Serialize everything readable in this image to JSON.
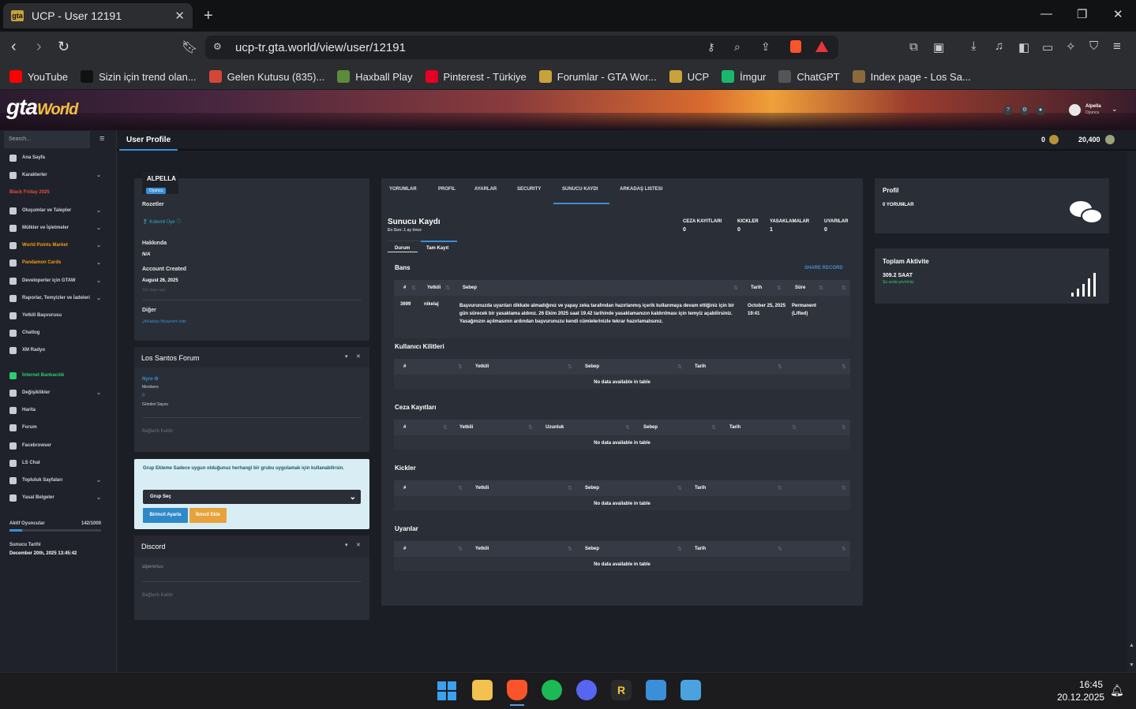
{
  "browser": {
    "tab_title": "UCP - User 12191",
    "url": "ucp-tr.gta.world/view/user/12191",
    "bookmarks": [
      {
        "label": "YouTube",
        "icon": "youtube-icon",
        "color": "#ff0000"
      },
      {
        "label": "Sizin için trend olan...",
        "icon": "tiktok-icon",
        "color": "#111111"
      },
      {
        "label": "Gelen Kutusu (835)...",
        "icon": "gmail-icon",
        "color": "#d44638"
      },
      {
        "label": "Haxball Play",
        "icon": "haxball-icon",
        "color": "#5b8c3a"
      },
      {
        "label": "Pinterest - Türkiye",
        "icon": "pinterest-icon",
        "color": "#e60023"
      },
      {
        "label": "Forumlar - GTA Wor...",
        "icon": "gtaw-icon",
        "color": "#c9a23c"
      },
      {
        "label": "UCP",
        "icon": "gtaw-icon",
        "color": "#c9a23c"
      },
      {
        "label": "İmgur",
        "icon": "imgur-icon",
        "color": "#1bb76e"
      },
      {
        "label": "ChatGPT",
        "icon": "chatgpt-icon",
        "color": "#555555"
      },
      {
        "label": "Index page - Los Sa...",
        "icon": "lspd-icon",
        "color": "#8a6a3a"
      }
    ]
  },
  "site": {
    "logo": "gta",
    "logo_sub": "World",
    "user_name": "Alpella",
    "user_role": "Oyuncu",
    "search_placeholder": "Search...",
    "page_tab": "User Profile",
    "coins": "0",
    "points": "20,400"
  },
  "sidebar": {
    "items": [
      {
        "label": "Ana Sayfa",
        "chev": false,
        "color": "#cfd3da"
      },
      {
        "label": "Karakterler",
        "chev": true,
        "color": "#cfd3da"
      },
      {
        "label": "Black Friday 2025",
        "chev": false,
        "color": "#e74c3c"
      },
      {
        "label": "Oluşumlar ve Talepler",
        "chev": true,
        "color": "#cfd3da"
      },
      {
        "label": "Mülkler ve İşletmeler",
        "chev": true,
        "color": "#cfd3da"
      },
      {
        "label": "World Points Market",
        "chev": true,
        "color": "#f39c12"
      },
      {
        "label": "Pandamon Cards",
        "chev": true,
        "color": "#f39c12"
      },
      {
        "label": "Developerler için GTAW",
        "chev": true,
        "color": "#cfd3da"
      },
      {
        "label": "Raporlar, Temyizler ve İadeleri",
        "chev": true,
        "color": "#cfd3da"
      },
      {
        "label": "Yetkili Başvurusu",
        "chev": false,
        "color": "#cfd3da"
      },
      {
        "label": "Chatlog",
        "chev": false,
        "color": "#cfd3da"
      },
      {
        "label": "XM Radyo",
        "chev": false,
        "color": "#cfd3da"
      },
      {
        "label": "İnternet Bankacılık",
        "chev": false,
        "color": "#2ecc71"
      },
      {
        "label": "Değişiklikler",
        "chev": true,
        "color": "#cfd3da"
      },
      {
        "label": "Harita",
        "chev": false,
        "color": "#cfd3da"
      },
      {
        "label": "Forum",
        "chev": false,
        "color": "#cfd3da"
      },
      {
        "label": "Facebrowser",
        "chev": false,
        "color": "#cfd3da"
      },
      {
        "label": "LS Chat",
        "chev": false,
        "color": "#cfd3da"
      },
      {
        "label": "Topluluk Sayfaları",
        "chev": true,
        "color": "#cfd3da"
      },
      {
        "label": "Yasal Belgeler",
        "chev": true,
        "color": "#cfd3da"
      }
    ],
    "active_players_label": "Aktif Oyuncular",
    "active_players": "142/1000",
    "active_fraction": 0.142,
    "server_date_label": "Sunucu Tarihi",
    "server_date": "December 20th, 2025 13:45:42"
  },
  "profile": {
    "name": "ALPELLA",
    "role": "Oyuncu",
    "badges_label": "Rozetler",
    "badge": "Kıdemli Üye",
    "about_label": "Hakkında",
    "about": "N/A",
    "created_label": "Account Created",
    "created": "August 26, 2025",
    "created_ago": "116 days ago",
    "other_label": "Diğer",
    "other_link": "Arkadaşı hikayesini indir"
  },
  "forum": {
    "title": "Los Santos Forum",
    "user": "Nyro",
    "role": "Members",
    "count": "0",
    "count_label": "Gönderi Sayısı",
    "unlink": "Bağlantı Kaldır"
  },
  "group": {
    "text": "Grup Ekleme Sadece uygun olduğunuz herhangi bir grubu uygulamak için kullanabilirsin.",
    "select": "Grup Seç",
    "btn1": "Birincil Ayarla",
    "btn2": "İkincil Ekle"
  },
  "discord": {
    "title": "Discord",
    "user": "alperenuu",
    "unlink": "Bağlantı Kaldır"
  },
  "tabs": [
    "YORUMLAR",
    "PROFIL",
    "AYARLAR",
    "SECURITY",
    "SUNUCU KAYDI",
    "ARKADAŞ LISTESI"
  ],
  "record": {
    "title": "Sunucu Kaydı",
    "last": "En Son: 1 ay önce",
    "stats": [
      {
        "label": "CEZA KAYITLARI",
        "value": "0"
      },
      {
        "label": "KICKLER",
        "value": "0"
      },
      {
        "label": "YASAKLAMALAR",
        "value": "1"
      },
      {
        "label": "UYARILAR",
        "value": "0"
      }
    ],
    "subtabs": [
      "Durum",
      "Tam Kayıt"
    ],
    "share": "SHARE RECORD",
    "no_data": "No data available in table",
    "bans": {
      "title": "Bans",
      "headers": [
        "#",
        "Yetkili",
        "Sebep",
        "Tarih",
        "Süre"
      ],
      "row": {
        "id": "3699",
        "staff": "nikelaj",
        "reason": "Başvurunuzda uyarıları dikkate almadığınız ve yapay zeka tarafından hazırlanmış içerik kullanmaya devam ettiğiniz için bir gün sürecek bir yasaklama aldınız. 26 Ekim 2025 saat 19.42 tarihinde yasaklamanızın kaldırılması için temyiz açabilirsiniz. Yasağınızın açılmasının ardından başvurunuzu kendi cümlelerinizle tekrar hazırlamalısınız.",
        "date": "October 25, 2025 19:41",
        "duration": "Permanent (Lifted)"
      }
    },
    "locks": {
      "title": "Kullanıcı Kilitleri",
      "headers": [
        "#",
        "Yetkili",
        "Sebep",
        "Tarih"
      ]
    },
    "penalties": {
      "title": "Ceza Kayıtları",
      "headers": [
        "#",
        "Yetkili",
        "Uzunluk",
        "Sebep",
        "Tarih"
      ]
    },
    "kicks": {
      "title": "Kickler",
      "headers": [
        "#",
        "Yetkili",
        "Sebep",
        "Tarih"
      ]
    },
    "warnings": {
      "title": "Uyarılar",
      "headers": [
        "#",
        "Yetkili",
        "Sebep",
        "Tarih"
      ]
    }
  },
  "right": {
    "profile_title": "Profil",
    "comments": "0 YORUMLAR",
    "activity_title": "Toplam Aktivite",
    "hours": "309.2 SAAT",
    "activity_sub": "Şu anda çevrimiçi"
  },
  "taskbar": {
    "time": "16:45",
    "date": "20.12.2025"
  }
}
